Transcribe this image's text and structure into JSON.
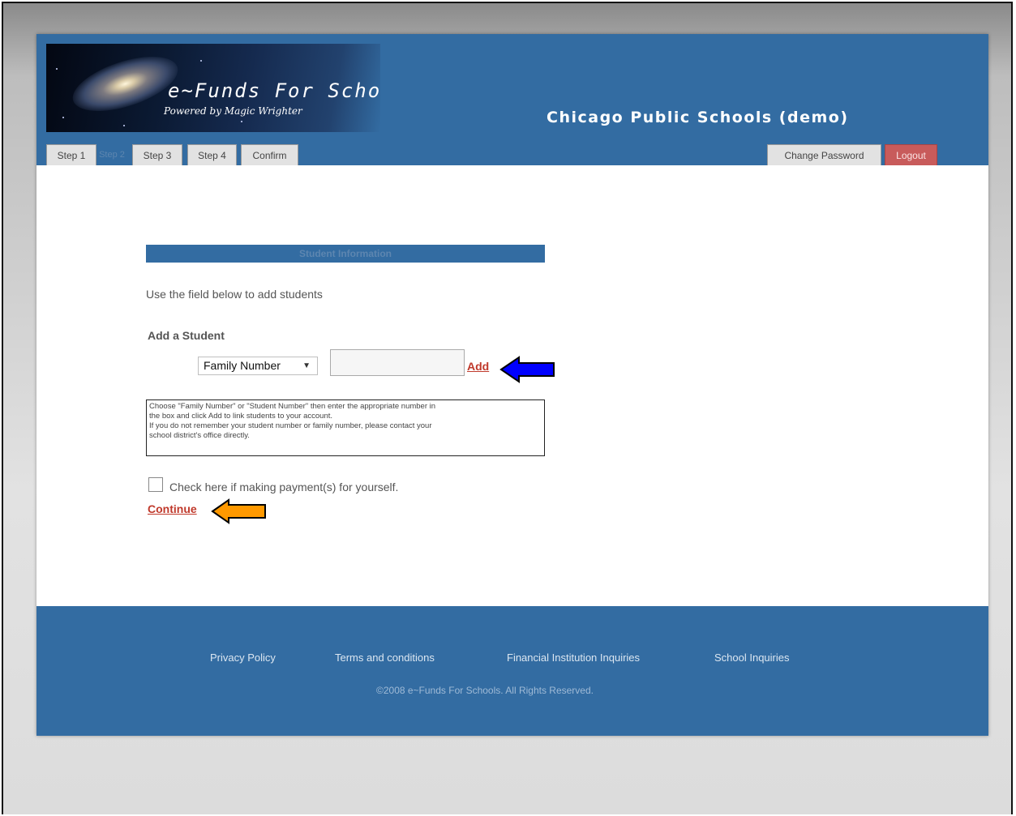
{
  "logo": {
    "title": "e~Funds For Schools",
    "subtitle": "Powered by Magic Wrighter"
  },
  "district": "Chicago Public Schools (demo)",
  "tabs": {
    "step1": "Step 1",
    "step2": "Step 2",
    "step3": "Step 3",
    "step4": "Step 4",
    "confirm": "Confirm"
  },
  "account_tabs": {
    "change_password": "Change Password",
    "logout": "Logout"
  },
  "section": {
    "title": "Student Information",
    "intro": "Use the field below to add students",
    "add_label": "Add a Student",
    "select_value": "Family Number",
    "input_value": "",
    "add_link": "Add",
    "help_lines": [
      "Choose \"Family Number\" or \"Student Number\" then enter the appropriate number in",
      "the box and click Add to link students to your account.",
      "If you do not remember your student number or family number, please contact your",
      "school district's office directly."
    ],
    "checkbox_label": "Check here if making payment(s) for yourself.",
    "continue_link": "Continue"
  },
  "footer": {
    "links": [
      "Privacy Policy",
      "Terms and conditions",
      "Financial Institution Inquiries",
      "School Inquiries"
    ],
    "copyright": "©2008 e~Funds For Schools. All Rights Reserved."
  },
  "annotations": {
    "blue_arrow_color": "#0000ff",
    "orange_arrow_color": "#ff9900"
  }
}
